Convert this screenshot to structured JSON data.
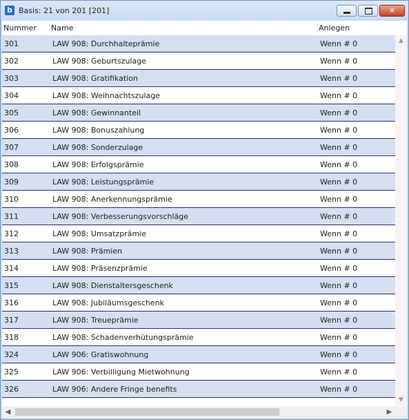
{
  "window": {
    "app_icon": "b",
    "title": "Basis: 21 von 201 [201]",
    "buttons": {
      "minimize": "minimize-icon",
      "maximize": "maximize-icon",
      "close_glyph": "✕"
    }
  },
  "table": {
    "columns": [
      "Nummer",
      "Name",
      "Anlegen"
    ],
    "rows": [
      {
        "nummer": "301",
        "name": "LAW 908: Durchhalteprämie",
        "anlegen": "Wenn # 0"
      },
      {
        "nummer": "302",
        "name": "LAW 908: Geburtszulage",
        "anlegen": "Wenn # 0"
      },
      {
        "nummer": "303",
        "name": "LAW 908: Gratifikation",
        "anlegen": "Wenn # 0"
      },
      {
        "nummer": "304",
        "name": "LAW 908: Weihnachtszulage",
        "anlegen": "Wenn # 0"
      },
      {
        "nummer": "305",
        "name": "LAW 908: Gewinnanteil",
        "anlegen": "Wenn # 0"
      },
      {
        "nummer": "306",
        "name": "LAW 908: Bonuszahlung",
        "anlegen": "Wenn # 0"
      },
      {
        "nummer": "307",
        "name": "LAW 908: Sonderzulage",
        "anlegen": "Wenn # 0"
      },
      {
        "nummer": "308",
        "name": "LAW 908: Erfolgsprämie",
        "anlegen": "Wenn # 0"
      },
      {
        "nummer": "309",
        "name": "LAW 908: Leistungsprämie",
        "anlegen": "Wenn # 0"
      },
      {
        "nummer": "310",
        "name": "LAW 908: Anerkennungsprämie",
        "anlegen": "Wenn # 0"
      },
      {
        "nummer": "311",
        "name": "LAW 908: Verbesserungsvorschläge",
        "anlegen": "Wenn # 0"
      },
      {
        "nummer": "312",
        "name": "LAW 908: Umsatzprämie",
        "anlegen": "Wenn # 0"
      },
      {
        "nummer": "313",
        "name": "LAW 908: Prämien",
        "anlegen": "Wenn # 0"
      },
      {
        "nummer": "314",
        "name": "LAW 908: Präsenzprämie",
        "anlegen": "Wenn # 0"
      },
      {
        "nummer": "315",
        "name": "LAW 908: Dienstaltersgeschenk",
        "anlegen": "Wenn # 0"
      },
      {
        "nummer": "316",
        "name": "LAW 908: Jubiläumsgeschenk",
        "anlegen": "Wenn # 0"
      },
      {
        "nummer": "317",
        "name": "LAW 908: Treueprämie",
        "anlegen": "Wenn # 0"
      },
      {
        "nummer": "318",
        "name": "LAW 908: Schadenverhütungsprämie",
        "anlegen": "Wenn # 0"
      },
      {
        "nummer": "324",
        "name": "LAW 906: Gratiswohnung",
        "anlegen": "Wenn # 0"
      },
      {
        "nummer": "325",
        "name": "LAW 906: Verbilligung Mietwohnung",
        "anlegen": "Wenn # 0"
      },
      {
        "nummer": "326",
        "name": "LAW 906: Andere Fringe benefits",
        "anlegen": "Wenn # 0"
      }
    ]
  },
  "scrollbars": {
    "up_icon": "chevron-up-icon",
    "down_icon": "chevron-down-icon",
    "left_icon": "chevron-left-icon",
    "right_icon": "chevron-right-icon"
  },
  "colors": {
    "row_alt": "#d5dfef",
    "row_border": "#2b2b7a",
    "title_bar": "#c8dbf1",
    "close_button": "#c7432b"
  }
}
